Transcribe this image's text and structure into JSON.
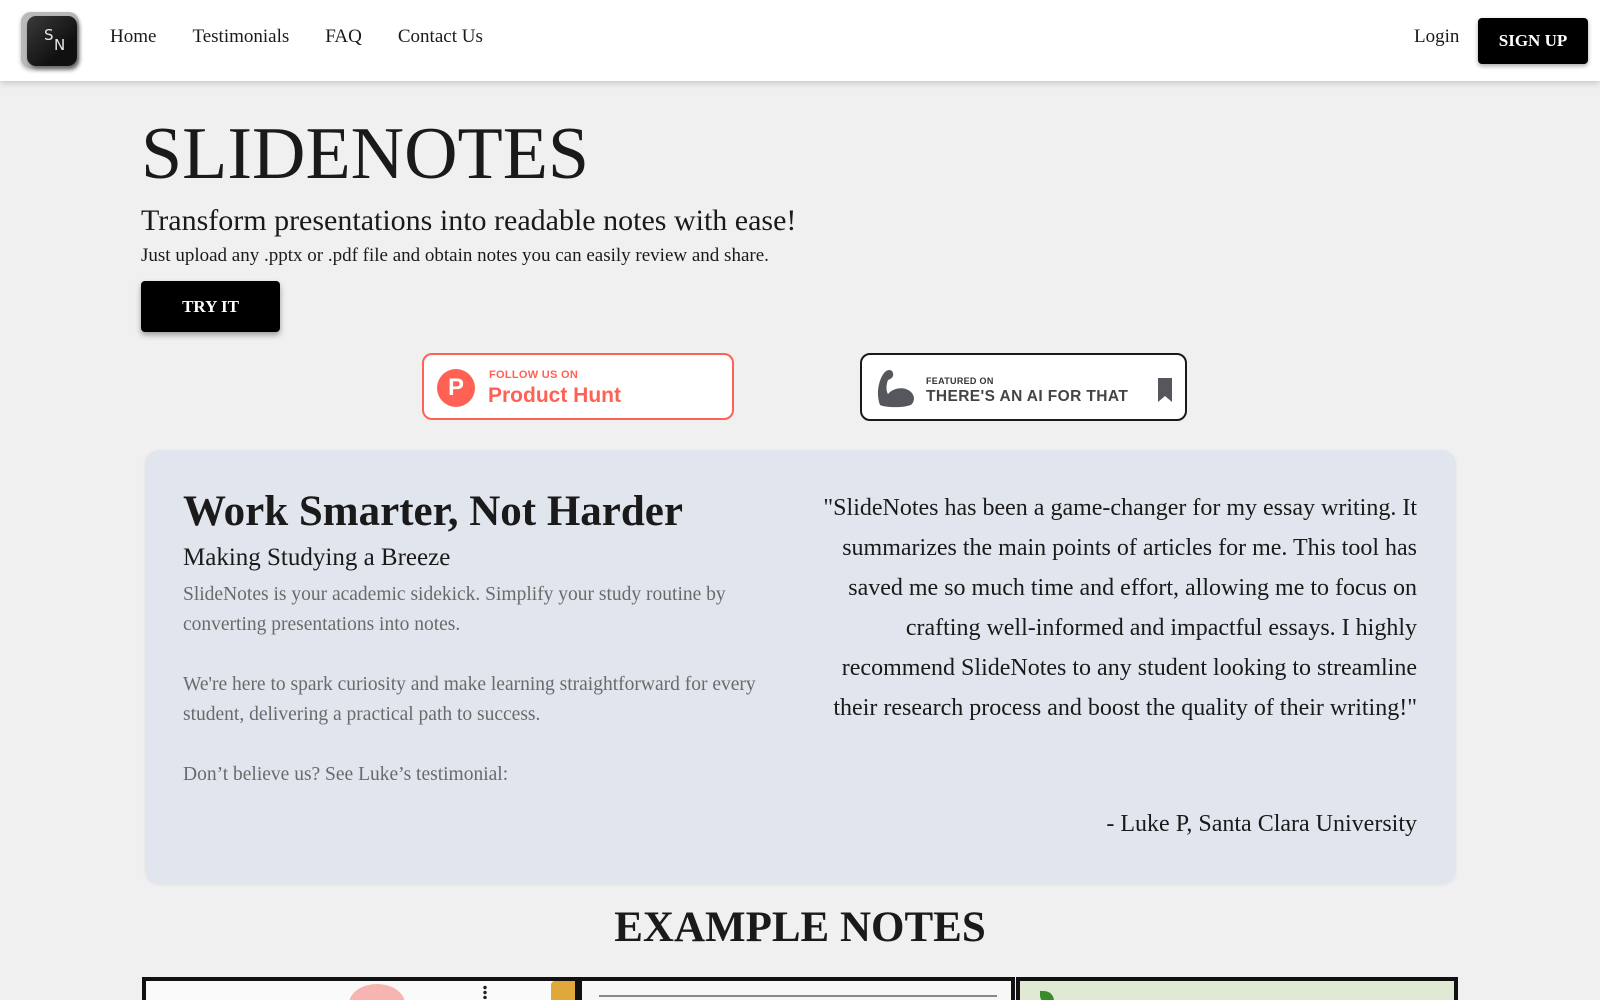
{
  "nav": {
    "logo_letters": [
      "S",
      "N"
    ],
    "links": [
      "Home",
      "Testimonials",
      "FAQ",
      "Contact Us"
    ],
    "login": "Login",
    "signup": "SIGN UP"
  },
  "hero": {
    "title": "SLIDENOTES",
    "subtitle": "Transform presentations into readable notes with ease!",
    "description": "Just upload any .pptx or .pdf file and obtain notes you can easily review and share.",
    "cta": "TRY IT"
  },
  "badges": {
    "product_hunt": {
      "small": "FOLLOW US ON",
      "big": "Product Hunt",
      "letter": "P",
      "color": "#ff6154"
    },
    "ai_for_that": {
      "small": "FEATURED ON",
      "big": "THERE'S AN AI FOR THAT"
    }
  },
  "panel": {
    "title": "Work Smarter, Not Harder",
    "subtitle": "Making Studying a Breeze",
    "paragraphs": [
      "SlideNotes is your academic sidekick. Simplify your study routine by converting presentations into notes.",
      "We're here to spark curiosity and make learning straightforward for every student, delivering a practical path to success.",
      "Don’t believe us? See Luke’s testimonial:"
    ],
    "quote": "\"SlideNotes has been a game-changer for my essay writing. It summarizes the main points of articles for me. This tool has saved me so much time and effort, allowing me to focus on crafting well-informed and impactful essays. I highly recommend SlideNotes to any student looking to streamline their research process and boost the quality of their writing!\"",
    "attribution": "- Luke P, Santa Clara University"
  },
  "examples": {
    "title": "EXAMPLE NOTES"
  },
  "colors": {
    "background": "#f0f0f0",
    "panel": "#e1e6ee",
    "button": "#000000",
    "product_hunt": "#ff6154"
  }
}
